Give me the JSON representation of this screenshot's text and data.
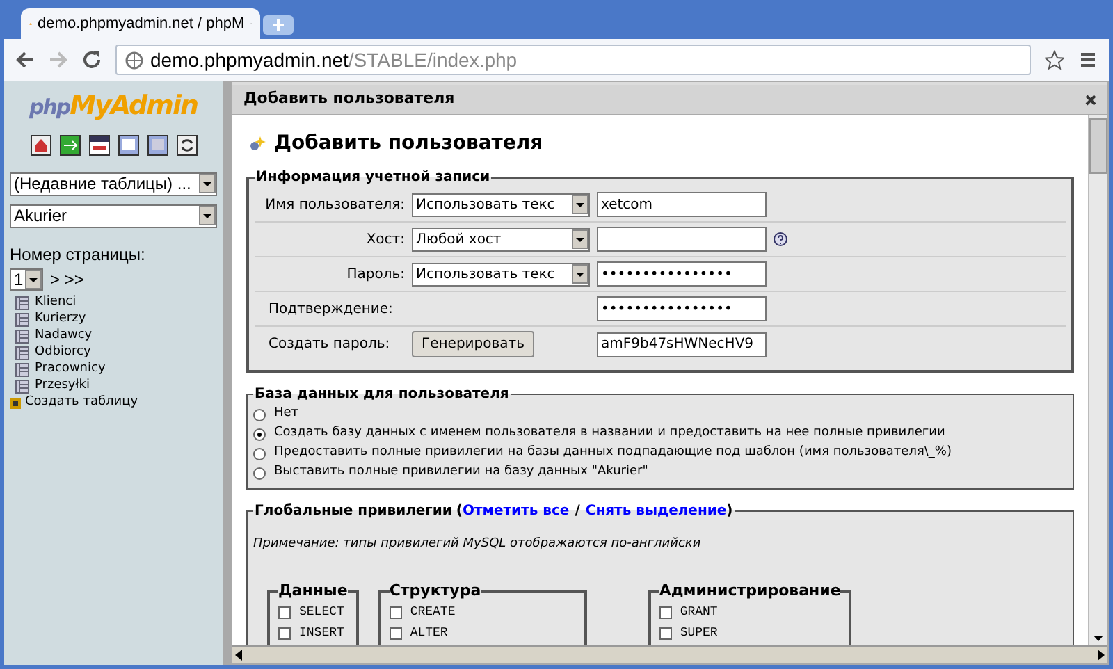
{
  "browser": {
    "tab_title": "demo.phpmyadmin.net / phpM",
    "url_host": "demo.phpmyadmin.net",
    "url_path": "/STABLE/index.php"
  },
  "sidebar": {
    "logo_php": "php",
    "logo_rest": "MyAdmin",
    "recent_select": "(Недавние таблицы) ...",
    "db_select": "Akurier",
    "page_label": "Номер страницы:",
    "page_select": "1",
    "page_nav": "> >>",
    "tables": [
      "Klienci",
      "Kurierzy",
      "Nadawcy",
      "Odbiorcy",
      "Pracownicy",
      "Przesyłki"
    ],
    "create_table": "Создать таблицу"
  },
  "dialog": {
    "title": "Добавить пользователя",
    "heading": "Добавить пользователя",
    "account": {
      "legend": "Информация учетной записи",
      "rows": [
        {
          "kind": "select_input",
          "label": "Имя пользователя:",
          "select": "Использовать текс",
          "value": "xetcom",
          "has_help": false
        },
        {
          "kind": "select_input",
          "label": "Хост:",
          "select": "Любой хост",
          "has_help": true
        },
        {
          "kind": "select_input",
          "label": "Пароль:",
          "select": "Использовать текс",
          "value": "••••••••••••••••",
          "has_help": false
        },
        {
          "kind": "input",
          "label": "Подтверждение:",
          "value": "••••••••••••••••",
          "has_help": false
        },
        {
          "kind": "button_input",
          "label": "Создать пароль:",
          "button": "Генерировать",
          "value": "amF9b47sHWNecHV9",
          "has_help": false
        }
      ]
    },
    "database": {
      "legend": "База данных для пользователя",
      "options": [
        {
          "label": "Нет",
          "selected": false
        },
        {
          "label": "Создать базу данных с именем пользователя в названии и предоставить на нее полные привилегии",
          "selected": true
        },
        {
          "label": "Предоставить полные привилегии на базы данных подпадающие под шаблон (имя пользователя\\_%)",
          "selected": false
        },
        {
          "label": "Выставить полные привилегии на базу данных \"Akurier\"",
          "selected": false
        }
      ]
    },
    "privileges": {
      "legend": "Глобальные привилегии",
      "open": "(",
      "check_all": "Отметить все",
      "separator": "/",
      "uncheck_all": "Снять выделение",
      "close": ")",
      "note": "Примечание: типы привилегий MySQL отображаются по-английски",
      "groups": [
        {
          "title": "Данные",
          "items": [
            {
              "label": "SELECT",
              "checked": false
            },
            {
              "label": "INSERT",
              "checked": false
            }
          ]
        },
        {
          "title": "Структура",
          "items": [
            {
              "label": "CREATE",
              "checked": false
            },
            {
              "label": "ALTER",
              "checked": false
            }
          ]
        },
        {
          "title": "Администрирование",
          "items": [
            {
              "label": "GRANT",
              "checked": false
            },
            {
              "label": "SUPER",
              "checked": false
            }
          ]
        }
      ]
    }
  }
}
